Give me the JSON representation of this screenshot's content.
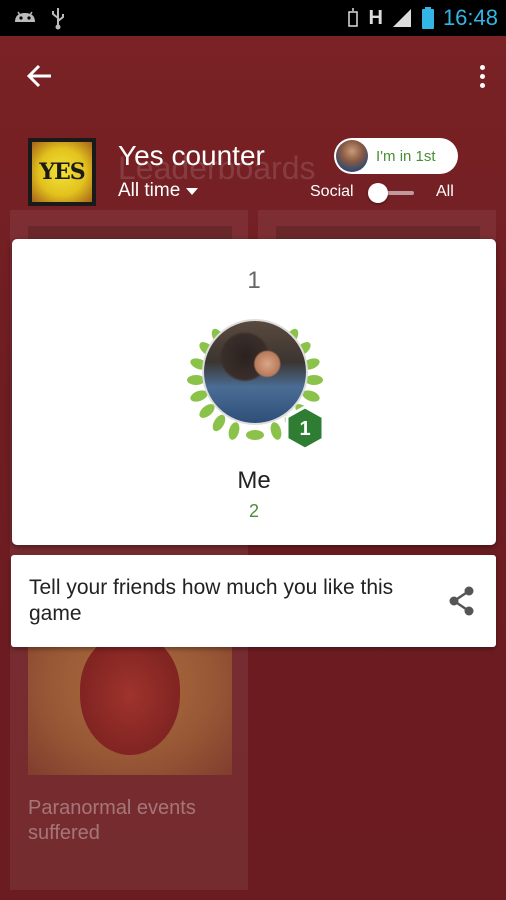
{
  "status_bar": {
    "time": "16:48",
    "network_type": "H"
  },
  "action_bar": {
    "back_icon": "arrow-back-icon",
    "menu_icon": "overflow-menu-icon"
  },
  "header": {
    "game_title": "Yes counter",
    "background_title": "Leaderboards",
    "time_filter": "All time",
    "rank_pill_label": "I'm in 1st",
    "toggle_left_label": "Social",
    "toggle_right_label": "All"
  },
  "game_icon_text": "YES",
  "leader_card": {
    "rank": "1",
    "player_name": "Me",
    "score": "2",
    "badge_rank": "1"
  },
  "share_card": {
    "text": "Tell your friends how much you like this game"
  },
  "background_tile": {
    "label": "Paranormal events suffered"
  },
  "colors": {
    "background": "#6e1d21",
    "accent_green": "#4a8f34",
    "badge_green": "#2e7d32",
    "status_blue": "#33b5e5"
  }
}
